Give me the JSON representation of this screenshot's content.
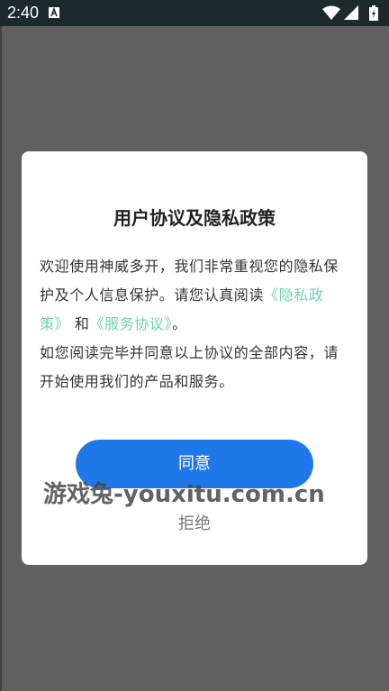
{
  "status_bar": {
    "time": "2:40",
    "notification_icon": "text-a-icon",
    "icons": [
      "wifi-icon",
      "signal-icon",
      "battery-icon"
    ]
  },
  "dialog": {
    "title": "用户协议及隐私政策",
    "body": {
      "line1": "欢迎使用神威多开，我们非常重视您的隐私保",
      "line2_prefix": "护及个人信息保护。请您认真阅读",
      "privacy_link_part1": "《隐私政",
      "privacy_link_part2": "策》",
      "and": "和",
      "service_link": "《服务协议》",
      "line3_suffix": "。",
      "line4": "如您阅读完毕并同意以上协议的全部内容，请",
      "line5": "开始使用我们的产品和服务。"
    },
    "agree_label": "同意",
    "reject_label": "拒绝"
  },
  "watermark": "游戏兔-youxitu.com.cn",
  "colors": {
    "status_bar": "#1d2a2c",
    "overlay": "#606060",
    "accent": "#1e78ea",
    "link": "#6fd1b0"
  }
}
